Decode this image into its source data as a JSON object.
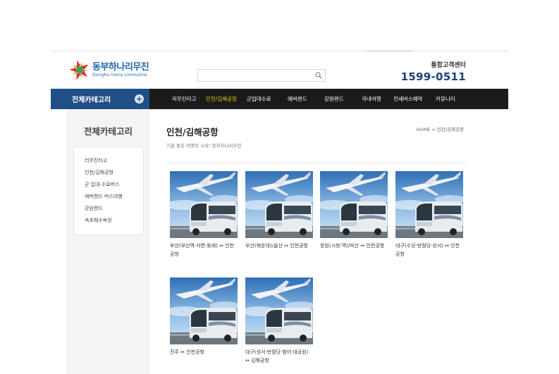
{
  "header": {
    "logo_ko": "동부하나리무진",
    "logo_en": "Dongbu Hana Limousine",
    "search_placeholder": "",
    "cs_label": "통합고객센터",
    "cs_phone": "1599-0511"
  },
  "nav": {
    "category_button": "전체카테고리",
    "items": [
      "리무진타고",
      "인천/김해공항",
      "군입대수료",
      "에버랜드",
      "강원랜드",
      "국내여행",
      "전세버스예약",
      "커뮤니티"
    ],
    "active_index": 1
  },
  "sidebar": {
    "title": "전체카테고리",
    "items": [
      "리무진타고",
      "인천/김해공항",
      "군 입대·수료버스",
      "에버랜드 버스여행",
      "강원랜드",
      "속초해수욕장"
    ]
  },
  "main": {
    "title": "인천/김해공항",
    "breadcrumb": "HOME > 인천/김해공항",
    "subtitle": "기분 좋은 여행의 시작! 동부하나리무진",
    "products": [
      {
        "caption": "부산(부산역·서면·동래) ↔ 인천공항"
      },
      {
        "caption": "부산(해운대)/울산 ↔ 인천공항"
      },
      {
        "caption": "창원(시청·역)/마산 ↔ 인천공항"
      },
      {
        "caption": "대구(수성·반월당·성서) ↔ 인천공항"
      },
      {
        "caption": "진주 ↔ 인천공항"
      },
      {
        "caption": "대구(성서·반월당·범어·대공원) ↔ 김해공항"
      }
    ]
  },
  "colors": {
    "nav_bg": "#1b1b1b",
    "category_bg": "#1f4f86",
    "active_menu": "#f1c40f",
    "phone": "#1d3f78"
  }
}
